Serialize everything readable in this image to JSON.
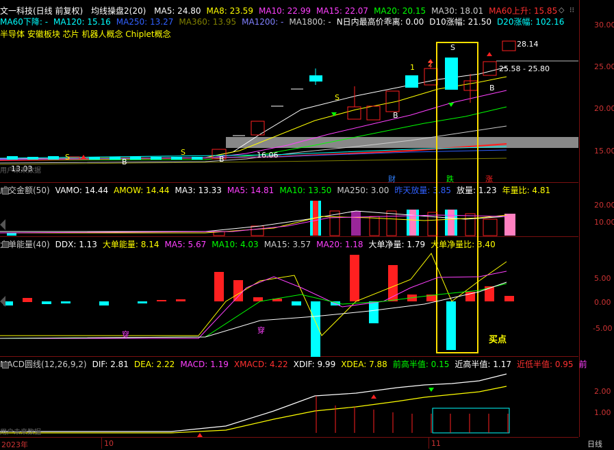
{
  "stock": {
    "name": "文一科技(日线 前复权)",
    "indicator": "均线操盘2(20)",
    "concepts": "半导体 安徽板块 芯片 机器人概念 Chiplet概念"
  },
  "ma_row1": [
    {
      "text": "MA5: 24.80",
      "color": "#ffffff"
    },
    {
      "text": "MA8: 23.59",
      "color": "#ffff00"
    },
    {
      "text": "MA10: 22.99",
      "color": "#ff40ff"
    },
    {
      "text": "MA15: 22.07",
      "color": "#ff40ff"
    },
    {
      "text": "MA20: 20.15",
      "color": "#00ff00"
    },
    {
      "text": "MA30: 18.01",
      "color": "#cccccc"
    },
    {
      "text": "MA60上升: 15.85",
      "color": "#ff3030"
    }
  ],
  "ma_row2": [
    {
      "text": "MA60下降: -",
      "color": "#00ffff"
    },
    {
      "text": "MA120: 15.16",
      "color": "#00ffff"
    },
    {
      "text": "MA250: 13.27",
      "color": "#3060ff"
    },
    {
      "text": "MA360: 13.95",
      "color": "#808000"
    },
    {
      "text": "MA1200: -",
      "color": "#8080ff"
    },
    {
      "text": "MA1800: -",
      "color": "#cccccc"
    },
    {
      "text": "N日内最高价乖离: 0.00",
      "color": "#ffffff"
    },
    {
      "text": "D10涨幅: 21.50",
      "color": "#ffffff"
    },
    {
      "text": "D20涨幅: 102.16",
      "color": "#00ffff"
    }
  ],
  "vol_row": [
    {
      "text": "成交金额(50)",
      "color": "#cccccc"
    },
    {
      "text": "VAMO: 14.44",
      "color": "#ffffff"
    },
    {
      "text": "AMOW: 14.44",
      "color": "#ffff00"
    },
    {
      "text": "MA3: 13.33",
      "color": "#ffffff"
    },
    {
      "text": "MA5: 14.81",
      "color": "#ff40ff"
    },
    {
      "text": "MA10: 13.50",
      "color": "#00ff00"
    },
    {
      "text": "MA250: 3.00",
      "color": "#cccccc"
    },
    {
      "text": "昨天放量: 3.85",
      "color": "#3060ff"
    },
    {
      "text": "放量: 1.23",
      "color": "#ffffff"
    },
    {
      "text": "年量比: 4.81",
      "color": "#ffff00"
    }
  ],
  "ddx_row": [
    {
      "text": "大单能量(40)",
      "color": "#cccccc"
    },
    {
      "text": "DDX: 1.13",
      "color": "#ffffff"
    },
    {
      "text": "大单能量: 8.14",
      "color": "#ffff00"
    },
    {
      "text": "MA5: 5.67",
      "color": "#ff40ff"
    },
    {
      "text": "MA10: 4.03",
      "color": "#00ff00"
    },
    {
      "text": "MA15: 3.57",
      "color": "#cccccc"
    },
    {
      "text": "MA20: 1.18",
      "color": "#ff40ff"
    },
    {
      "text": "大单净量: 1.79",
      "color": "#ffffff"
    },
    {
      "text": "大单净量比: 3.40",
      "color": "#ffff00"
    }
  ],
  "macd_row": [
    {
      "text": "MACD圆线(12,26,9,2)",
      "color": "#cccccc"
    },
    {
      "text": "DIF: 2.81",
      "color": "#ffffff"
    },
    {
      "text": "DEA: 2.22",
      "color": "#ffff00"
    },
    {
      "text": "MACD: 1.19",
      "color": "#ff40ff"
    },
    {
      "text": "XMACD: 4.22",
      "color": "#ff3030"
    },
    {
      "text": "XDIF: 9.99",
      "color": "#ffffff"
    },
    {
      "text": "XDEA: 7.88",
      "color": "#ffff00"
    },
    {
      "text": "前高半值: 0.15",
      "color": "#00ff00"
    },
    {
      "text": "近高半值: 1.17",
      "color": "#ffffff"
    },
    {
      "text": "近低半值: 0.95",
      "color": "#ff3030"
    },
    {
      "text": "前",
      "color": "#ff40ff"
    }
  ],
  "price_axis": [
    "30.00",
    "25.00",
    "20.00",
    "15.00"
  ],
  "vol_axis": [
    "20.00",
    "10.00"
  ],
  "ddx_axis": [
    "5.00",
    "0.00",
    "-5.00"
  ],
  "macd_axis": [
    "2.00",
    "1.00"
  ],
  "period_label": "日线",
  "date_labels": {
    "year": "2023年",
    "m10": "10",
    "m11": "11"
  },
  "annotations": {
    "last_price": "28.14",
    "range": "25.58 - 25.80",
    "low_price": "13.03",
    "mid_price": "16.06",
    "cai": "财",
    "die": "跌",
    "zhang": "涨",
    "buy_point": "买点",
    "chuan1": "穿",
    "chuan2": "穿",
    "watermark": "用户未来数据",
    "s_mark": "S",
    "b_mark": "B",
    "one": "1",
    "two": "2"
  },
  "colors": {
    "up": "#ff2020",
    "down": "#00ffff",
    "highlight": "#ffe000",
    "grid": "#7a1010"
  }
}
